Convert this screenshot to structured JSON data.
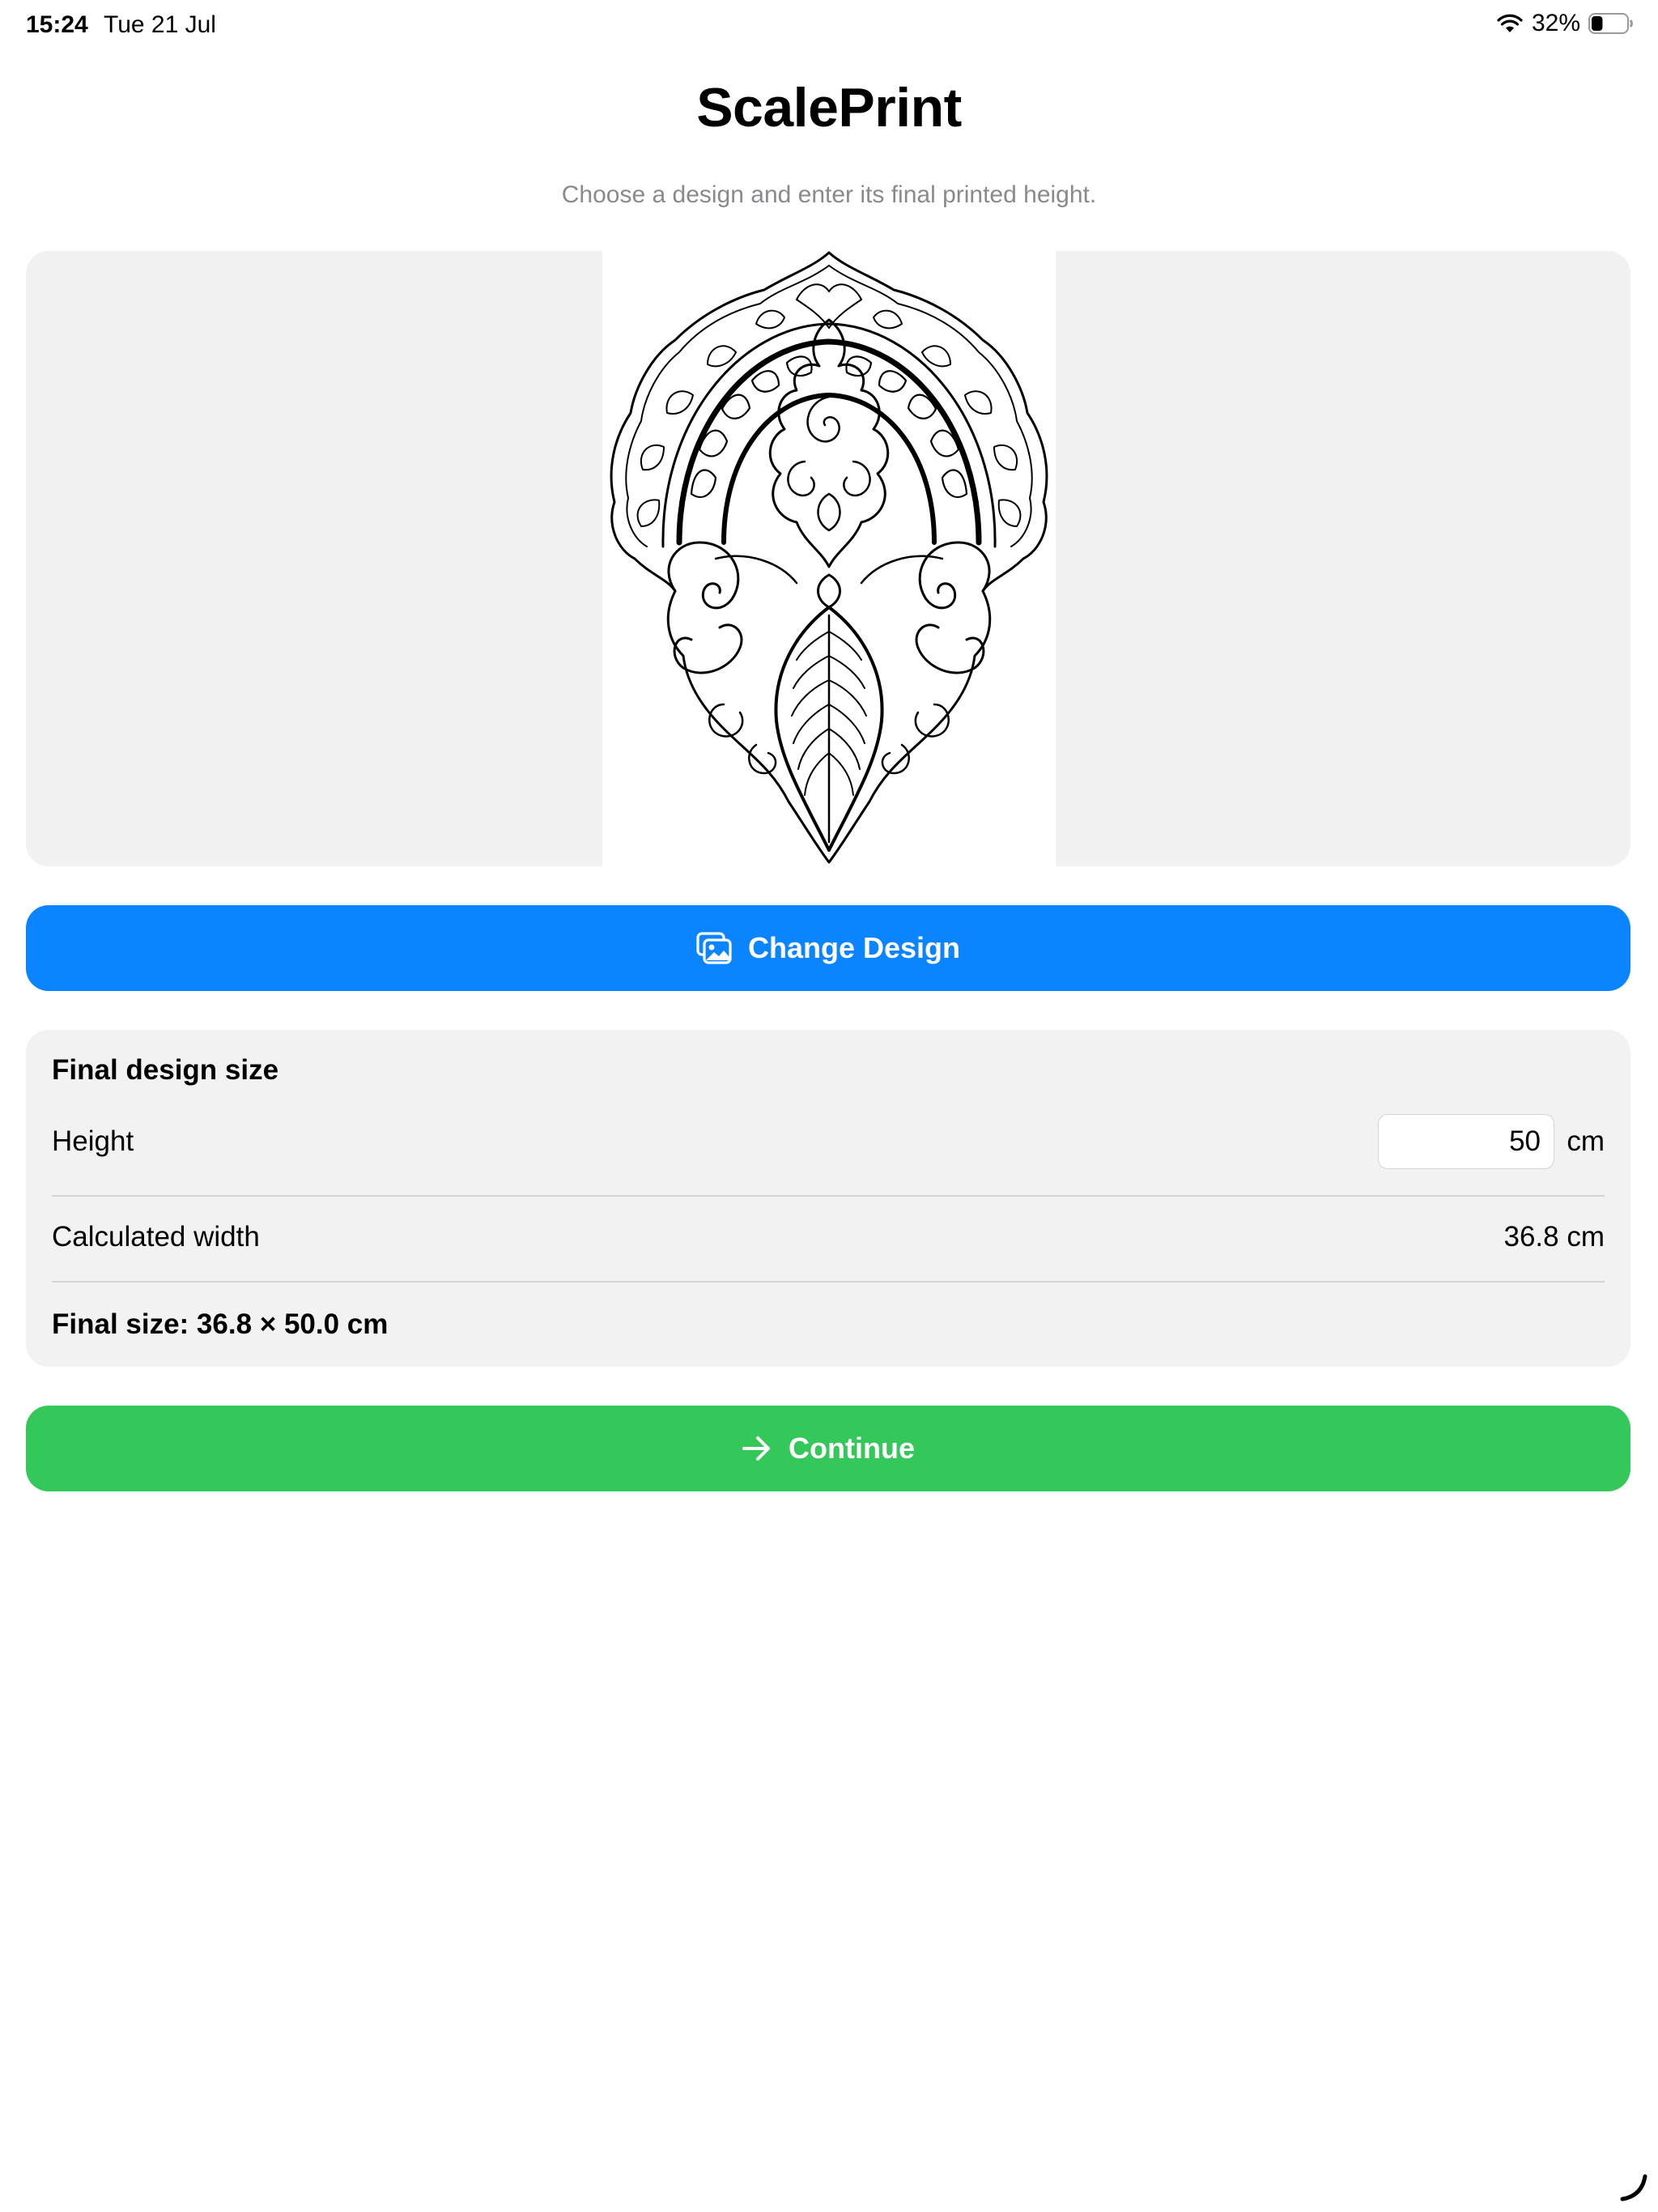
{
  "status_bar": {
    "time": "15:24",
    "date": "Tue 21 Jul",
    "battery_percent": "32%",
    "battery_level": 0.32,
    "wifi_icon": "wifi-icon",
    "battery_icon": "battery-icon"
  },
  "header": {
    "title": "ScalePrint",
    "subtitle": "Choose a design and enter its final printed height."
  },
  "preview": {
    "image_icon": "ornamental-design-image"
  },
  "change_design_button": {
    "label": "Change Design",
    "icon": "photo-stack-icon",
    "color": "#0a84ff"
  },
  "size_card": {
    "heading": "Final design size",
    "height_label": "Height",
    "height_value": "50",
    "height_unit": "cm",
    "width_label": "Calculated width",
    "width_value": "36.8 cm",
    "final_size": "Final size: 36.8 × 50.0 cm"
  },
  "continue_button": {
    "label": "Continue",
    "icon": "arrow-right-icon",
    "color": "#34c759"
  }
}
